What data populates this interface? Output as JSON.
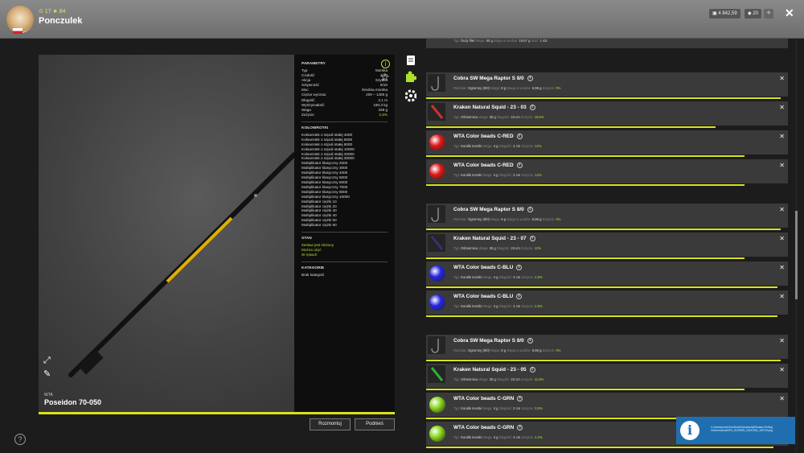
{
  "header": {
    "level_text": "⊙ 17  ★ 84",
    "username": "Ponczulek",
    "currency1": "4 842,59",
    "currency2": "20",
    "plus": "+",
    "close": "✕"
  },
  "rod": {
    "brand": "WTA",
    "name": "Poseidon 70-050",
    "buttons": {
      "dismantle": "Rozmontuj",
      "pickup": "Podnieś"
    }
  },
  "params": {
    "title": "PARAMETRY",
    "rows": [
      {
        "k": "Typ",
        "v": "Morska"
      },
      {
        "k": "Czułość",
        "v": "3/10"
      },
      {
        "k": "Akcja",
        "v": "Szybka"
      },
      {
        "k": "Sztywność",
        "v": "8/10"
      },
      {
        "k": "Moc",
        "v": "Średnia morska"
      },
      {
        "k": "Ciężar wyrzutu",
        "v": "200 – 1400 g"
      },
      {
        "k": "Długość",
        "v": "2,1 m"
      },
      {
        "k": "Wytrzymałość",
        "v": "180,3 kg"
      },
      {
        "k": "Waga",
        "v": "338 g"
      },
      {
        "k": "Zużycie",
        "v": "2,8%"
      }
    ],
    "reels_title": "KOŁOWROTKI",
    "reels": [
      "Kołowrotek o szpuli stałej 4000",
      "Kołowrotek o szpuli stałej 6000",
      "Kołowrotek o szpuli stałej 8000",
      "Kołowrotek o szpuli stałej 10000",
      "Kołowrotek o szpuli stałej 20000",
      "Kołowrotek o szpuli stałej 30000",
      "Multiplikator klasyczny 2000",
      "Multiplikator klasyczny 3000",
      "Multiplikator klasyczny 4000",
      "Multiplikator klasyczny 5000",
      "Multiplikator klasyczny 6000",
      "Multiplikator klasyczny 7000",
      "Multiplikator klasyczny 8000",
      "Multiplikator klasyczny 10000",
      "Multiplikator ciężki 10",
      "Multiplikator ciężki 20",
      "Multiplikator ciężki 30",
      "Multiplikator ciężki 40",
      "Multiplikator ciężki 50",
      "Multiplikator ciężki 60"
    ],
    "state_title": "STAN",
    "states": [
      "Zestaw jest złożony",
      "Można użyć",
      "W rękach"
    ],
    "category_title": "KATEGORIE",
    "category": "Brak kategorii"
  },
  "list": {
    "partial_meta": {
      "typ_label": "Typ:",
      "typ": "Duży filet",
      "waga_label": "Waga:",
      "waga": "50 g",
      "w_label": "Waga w wodzie:",
      "w": "19,67 g",
      "ilosc_label": "Ilość:",
      "ilosc": "1 szt."
    },
    "items": [
      {
        "name": "Cobra SW Mega Raptor S 8/0",
        "kind": "hook",
        "f1": "Rozmiar:",
        "v1": "Ogromny (8/0)",
        "f2": "Waga:",
        "v2": "8 g",
        "f3": "Waga w wodzie:",
        "v3": "6,98 g",
        "f4": "Zużycie:",
        "v4": "0%",
        "wear": 0.98
      },
      {
        "name": "Kraken Natural Squid - 23 - 03",
        "kind": "squid",
        "color": "#d03030",
        "f1": "Typ:",
        "v1": "Ośmiornica",
        "f2": "Waga:",
        "v2": "30 g",
        "f3": "Długość:",
        "v3": "23 cm",
        "f4": "Zużycie:",
        "v4": "19,6%",
        "wear": 0.8
      },
      {
        "name": "WTA Color beads C-RED",
        "kind": "ball",
        "color": "#e01818",
        "f1": "Typ:",
        "v1": "Koralik morski",
        "f2": "Waga:",
        "v2": "4 g",
        "f3": "Długość:",
        "v3": "2 cm",
        "f4": "Zużycie:",
        "v4": "12%",
        "wear": 0.88
      },
      {
        "name": "WTA Color beads C-RED",
        "kind": "ball",
        "color": "#e01818",
        "f1": "Typ:",
        "v1": "Koralik morski",
        "f2": "Waga:",
        "v2": "4 g",
        "f3": "Długość:",
        "v3": "2 cm",
        "f4": "Zużycie:",
        "v4": "12%",
        "wear": 0.88
      },
      {
        "name": "Cobra SW Mega Raptor S 8/0",
        "kind": "hook",
        "f1": "Rozmiar:",
        "v1": "Ogromny (8/0)",
        "f2": "Waga:",
        "v2": "8 g",
        "f3": "Waga w wodzie:",
        "v3": "6,98 g",
        "f4": "Zużycie:",
        "v4": "0%",
        "wear": 0.98
      },
      {
        "name": "Kraken Natural Squid - 23 - 07",
        "kind": "squid",
        "color": "#3a3070",
        "f1": "Typ:",
        "v1": "Ośmiornica",
        "f2": "Waga:",
        "v2": "30 g",
        "f3": "Długość:",
        "v3": "23 cm",
        "f4": "Zużycie:",
        "v4": "12%",
        "wear": 0.88
      },
      {
        "name": "WTA Color beads C-BLU",
        "kind": "ball",
        "color": "#2424e0",
        "f1": "Typ:",
        "v1": "Koralik morski",
        "f2": "Waga:",
        "v2": "4 g",
        "f3": "Długość:",
        "v3": "2 cm",
        "f4": "Zużycie:",
        "v4": "2,8%",
        "wear": 0.97
      },
      {
        "name": "WTA Color beads C-BLU",
        "kind": "ball",
        "color": "#2424e0",
        "f1": "Typ:",
        "v1": "Koralik morski",
        "f2": "Waga:",
        "v2": "4 g",
        "f3": "Długość:",
        "v3": "2 cm",
        "f4": "Zużycie:",
        "v4": "2,9%",
        "wear": 0.97
      },
      {
        "name": "Cobra SW Mega Raptor S 8/0",
        "kind": "hook",
        "f1": "Rozmiar:",
        "v1": "Ogromny (8/0)",
        "f2": "Waga:",
        "v2": "8 g",
        "f3": "Waga w wodzie:",
        "v3": "6,98 g",
        "f4": "Zużycie:",
        "v4": "0%",
        "wear": 0.98
      },
      {
        "name": "Kraken Natural Squid - 23 - 05",
        "kind": "squid",
        "color": "#30b030",
        "f1": "Typ:",
        "v1": "Ośmiornica",
        "f2": "Waga:",
        "v2": "30 g",
        "f3": "Długość:",
        "v3": "23 cm",
        "f4": "Zużycie:",
        "v4": "11,6%",
        "wear": 0.88
      },
      {
        "name": "WTA Color beads C-GRN",
        "kind": "ball",
        "color": "#8ad81c",
        "f1": "Typ:",
        "v1": "Koralik morski",
        "f2": "Waga:",
        "v2": "4 g",
        "f3": "Długość:",
        "v3": "2 cm",
        "f4": "Zużycie:",
        "v4": "3,8%",
        "wear": 0.96
      },
      {
        "name": "WTA Color beads C-GRN",
        "kind": "ball",
        "color": "#8ad81c",
        "f1": "Typ:",
        "v1": "Koralik morski",
        "f2": "Waga:",
        "v2": "4 g",
        "f3": "Długość:",
        "v3": "2 cm",
        "f4": "Zużycie:",
        "v4": "4,3%",
        "wear": 0.96
      }
    ]
  },
  "toast": {
    "text": "C:\\Users\\punch\\OneDrive\\Dokumenty\\Russian Fishing 4\\Screenshots\\RF4_SCREEN_20231016_153718.png"
  },
  "help": "?",
  "close_mark": "✕",
  "info_mark": "i"
}
